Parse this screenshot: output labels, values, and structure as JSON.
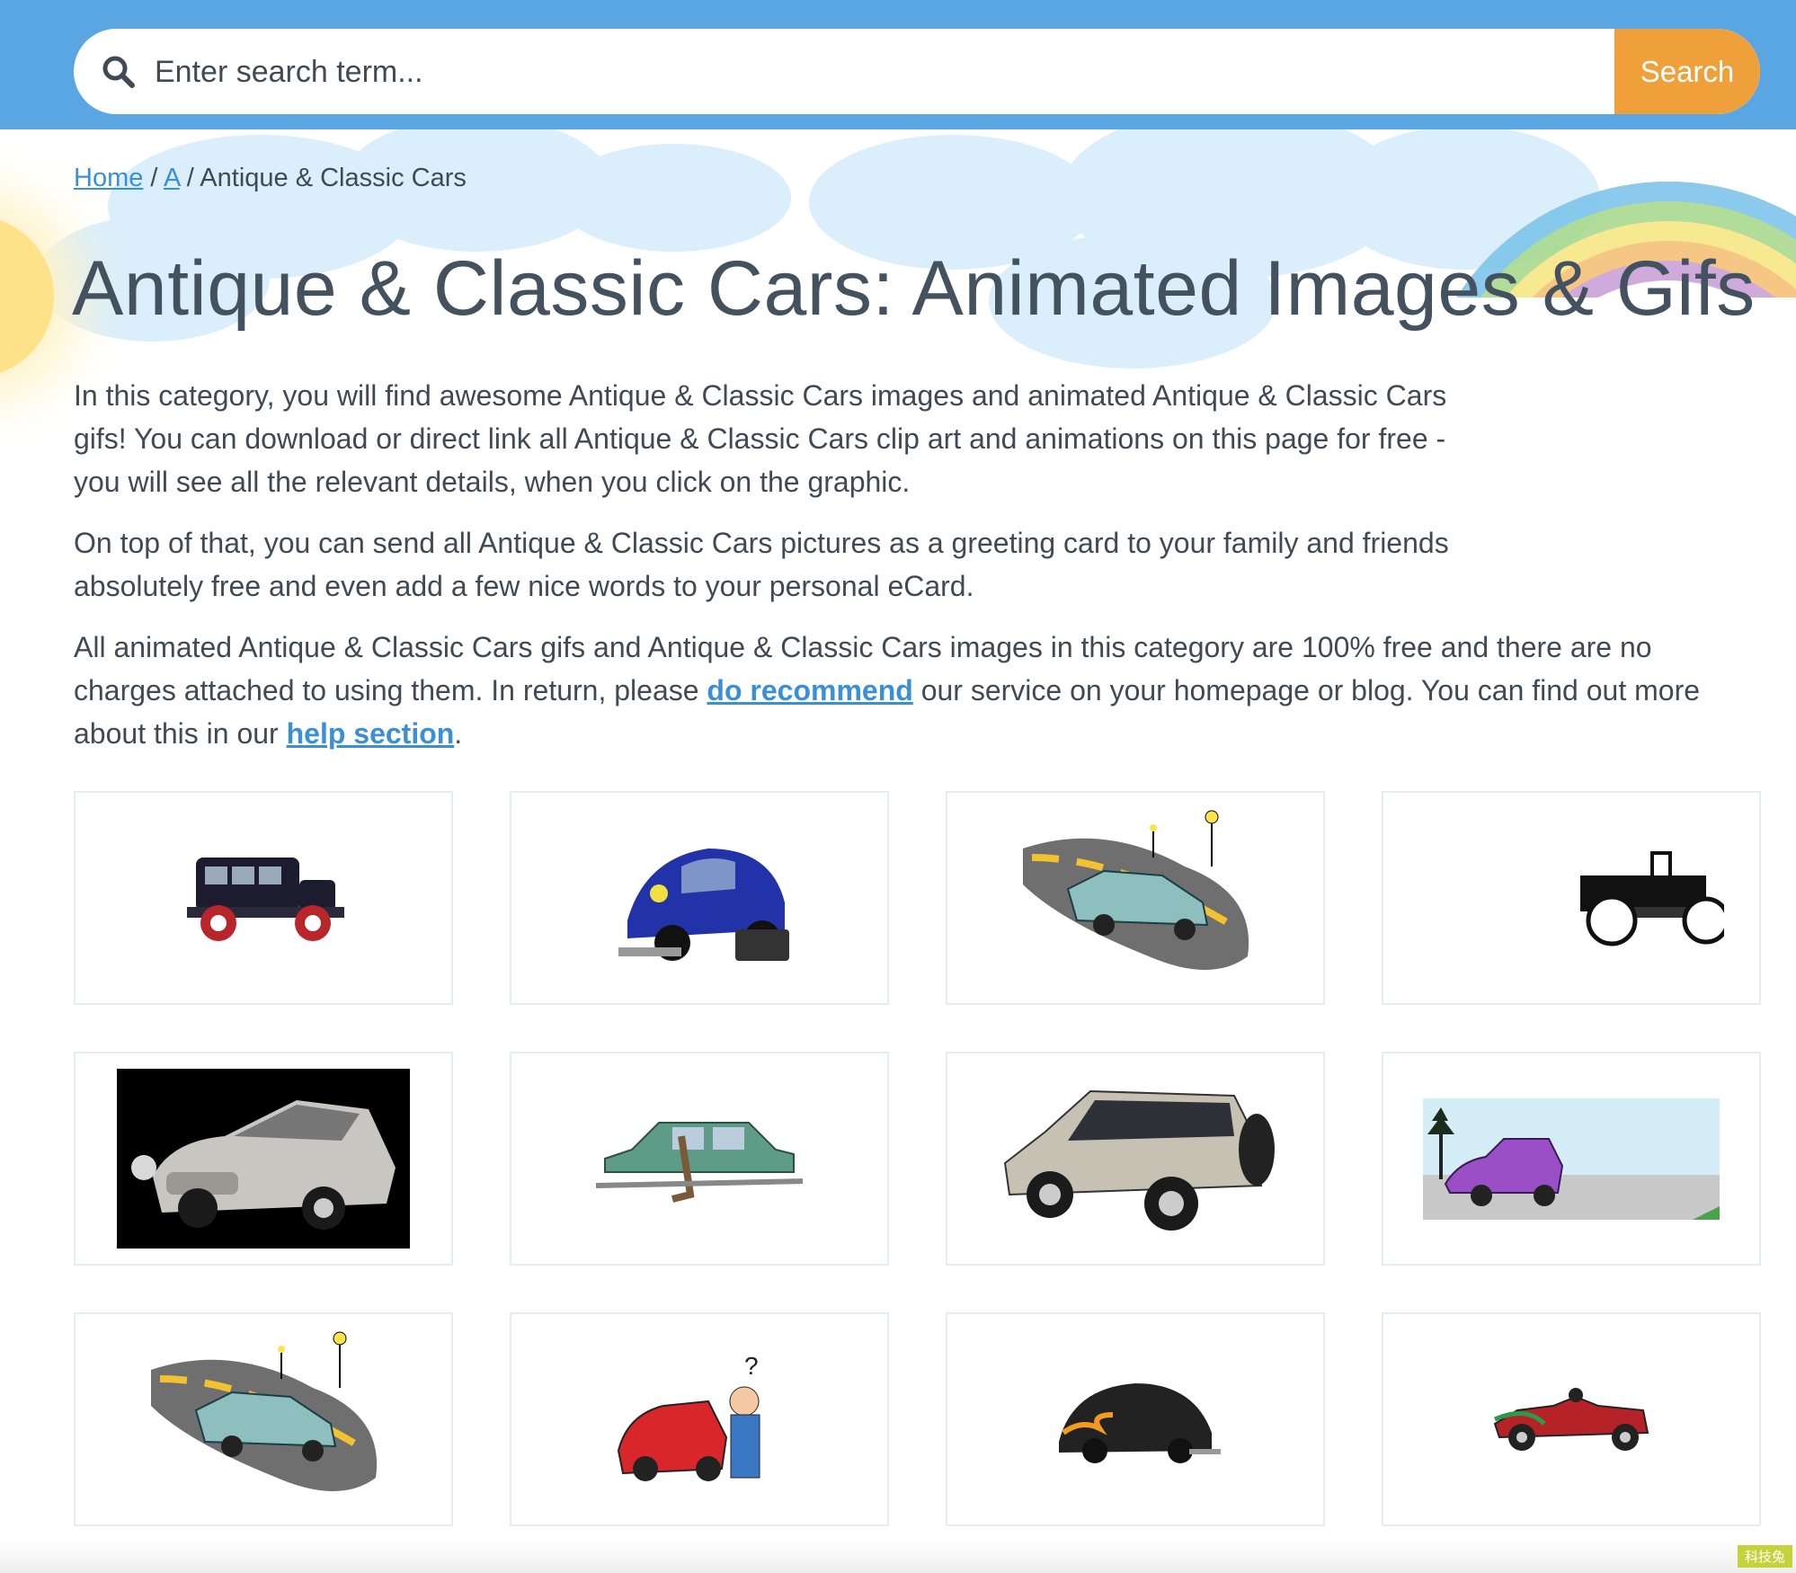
{
  "search": {
    "placeholder": "Enter search term...",
    "button_label": "Search"
  },
  "breadcrumb": {
    "home": "Home",
    "separator": "/",
    "letter": "A",
    "current": "Antique & Classic Cars"
  },
  "page_title": "Antique & Classic Cars: Animated Images & Gifs",
  "intro": {
    "p1": "In this category, you will find awesome Antique & Classic Cars images and animated Antique & Classic Cars gifs! You can download or direct link all Antique & Classic Cars clip art and animations on this page for free - you will see all the relevant details, when you click on the graphic.",
    "p2": "On top of that, you can send all Antique & Classic Cars pictures as a greeting card to your family and friends absolutely free and even add a few nice words to your personal eCard.",
    "p3_before": "All animated Antique & Classic Cars gifs and Antique & Classic Cars images in this category are 100% free and there are no charges attached to using them. In return, please ",
    "p3_link1": "do recommend",
    "p3_middle": " our service on your homepage or blog. You can find out more about this in our ",
    "p3_link2": "help section",
    "p3_after": "."
  },
  "gallery": [
    {
      "icon": "vintage-black-sedan-icon"
    },
    {
      "icon": "crashed-blue-beetle-icon"
    },
    {
      "icon": "teal-car-on-road-icon"
    },
    {
      "icon": "black-white-roadster-icon"
    },
    {
      "icon": "silver-sports-car-icon"
    },
    {
      "icon": "green-car-driver-icon"
    },
    {
      "icon": "silver-suv-icon"
    },
    {
      "icon": "purple-cartoon-car-icon"
    },
    {
      "icon": "teal-car-on-road-icon"
    },
    {
      "icon": "red-car-mechanic-icon"
    },
    {
      "icon": "flame-beetle-icon"
    },
    {
      "icon": "red-race-car-icon"
    }
  ],
  "colors": {
    "header": "#59a6e3",
    "search_button": "#f0a03a",
    "link": "#3a8fd6",
    "text": "#3f4a55"
  },
  "corner_badge": "科技兔"
}
